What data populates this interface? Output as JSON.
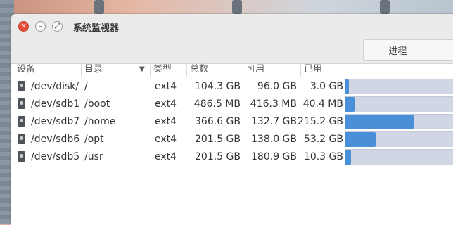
{
  "window": {
    "title": "系统监视器"
  },
  "toolbar": {
    "process_tab": "进程"
  },
  "columns": {
    "device": "设备",
    "mount": "目录",
    "type": "类型",
    "total": "总数",
    "available": "可用",
    "used": "已用"
  },
  "rows": [
    {
      "device": "/dev/disk/",
      "mount": "/",
      "type": "ext4",
      "total": "104.3 GB",
      "available": "96.0 GB",
      "used": "3.0 GB",
      "used_fraction": 0.03
    },
    {
      "device": "/dev/sdb1",
      "mount": "/boot",
      "type": "ext4",
      "total": "486.5 MB",
      "available": "416.3 MB",
      "used": "40.4 MB",
      "used_fraction": 0.08
    },
    {
      "device": "/dev/sdb7",
      "mount": "/home",
      "type": "ext4",
      "total": "366.6 GB",
      "available": "132.7 GB",
      "used": "215.2 GB",
      "used_fraction": 0.59
    },
    {
      "device": "/dev/sdb6",
      "mount": "/opt",
      "type": "ext4",
      "total": "201.5 GB",
      "available": "138.0 GB",
      "used": "53.2 GB",
      "used_fraction": 0.26
    },
    {
      "device": "/dev/sdb5",
      "mount": "/usr",
      "type": "ext4",
      "total": "201.5 GB",
      "available": "180.9 GB",
      "used": "10.3 GB",
      "used_fraction": 0.05
    }
  ],
  "colors": {
    "bar_fill": "#4a90d9",
    "bar_track": "#d1d6e4",
    "close_button": "#e94e3b"
  }
}
